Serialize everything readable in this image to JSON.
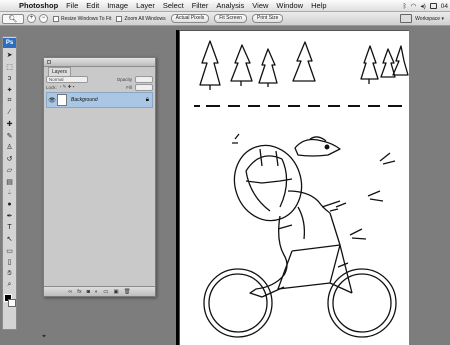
{
  "menubar": {
    "app_name": "Photoshop",
    "items": [
      "File",
      "Edit",
      "Image",
      "Layer",
      "Select",
      "Filter",
      "Analysis",
      "View",
      "Window",
      "Help"
    ],
    "status_time": "04"
  },
  "options_bar": {
    "resize_windows_to_fit": "Resize Windows To Fit",
    "zoom_all_windows": "Zoom All Windows",
    "actual_pixels": "Actual Pixels",
    "fit_screen": "Fit Screen",
    "print_size": "Print Size",
    "workspace": "Workspace ▾"
  },
  "tools_panel": {
    "logo": "Ps",
    "tools": [
      "move-icon",
      "marquee-icon",
      "lasso-icon",
      "magic-wand-icon",
      "crop-icon",
      "eyedropper-icon",
      "healing-icon",
      "brush-icon",
      "stamp-icon",
      "history-brush-icon",
      "eraser-icon",
      "gradient-icon",
      "blur-icon",
      "dodge-icon",
      "pen-icon",
      "type-icon",
      "path-select-icon",
      "shape-icon",
      "notes-icon",
      "hand-icon",
      "zoom-icon"
    ]
  },
  "layers_panel": {
    "tab_label": "Layers",
    "blend_mode": "Normal",
    "opacity_label": "Opacity",
    "fill_label": "Fill",
    "lock_label": "Lock:",
    "layers": [
      {
        "name": "Background",
        "visible": true,
        "locked": true
      }
    ]
  },
  "colors": {
    "selected_layer": "#a9c6e4",
    "workspace_bg": "#7d7d7d"
  }
}
